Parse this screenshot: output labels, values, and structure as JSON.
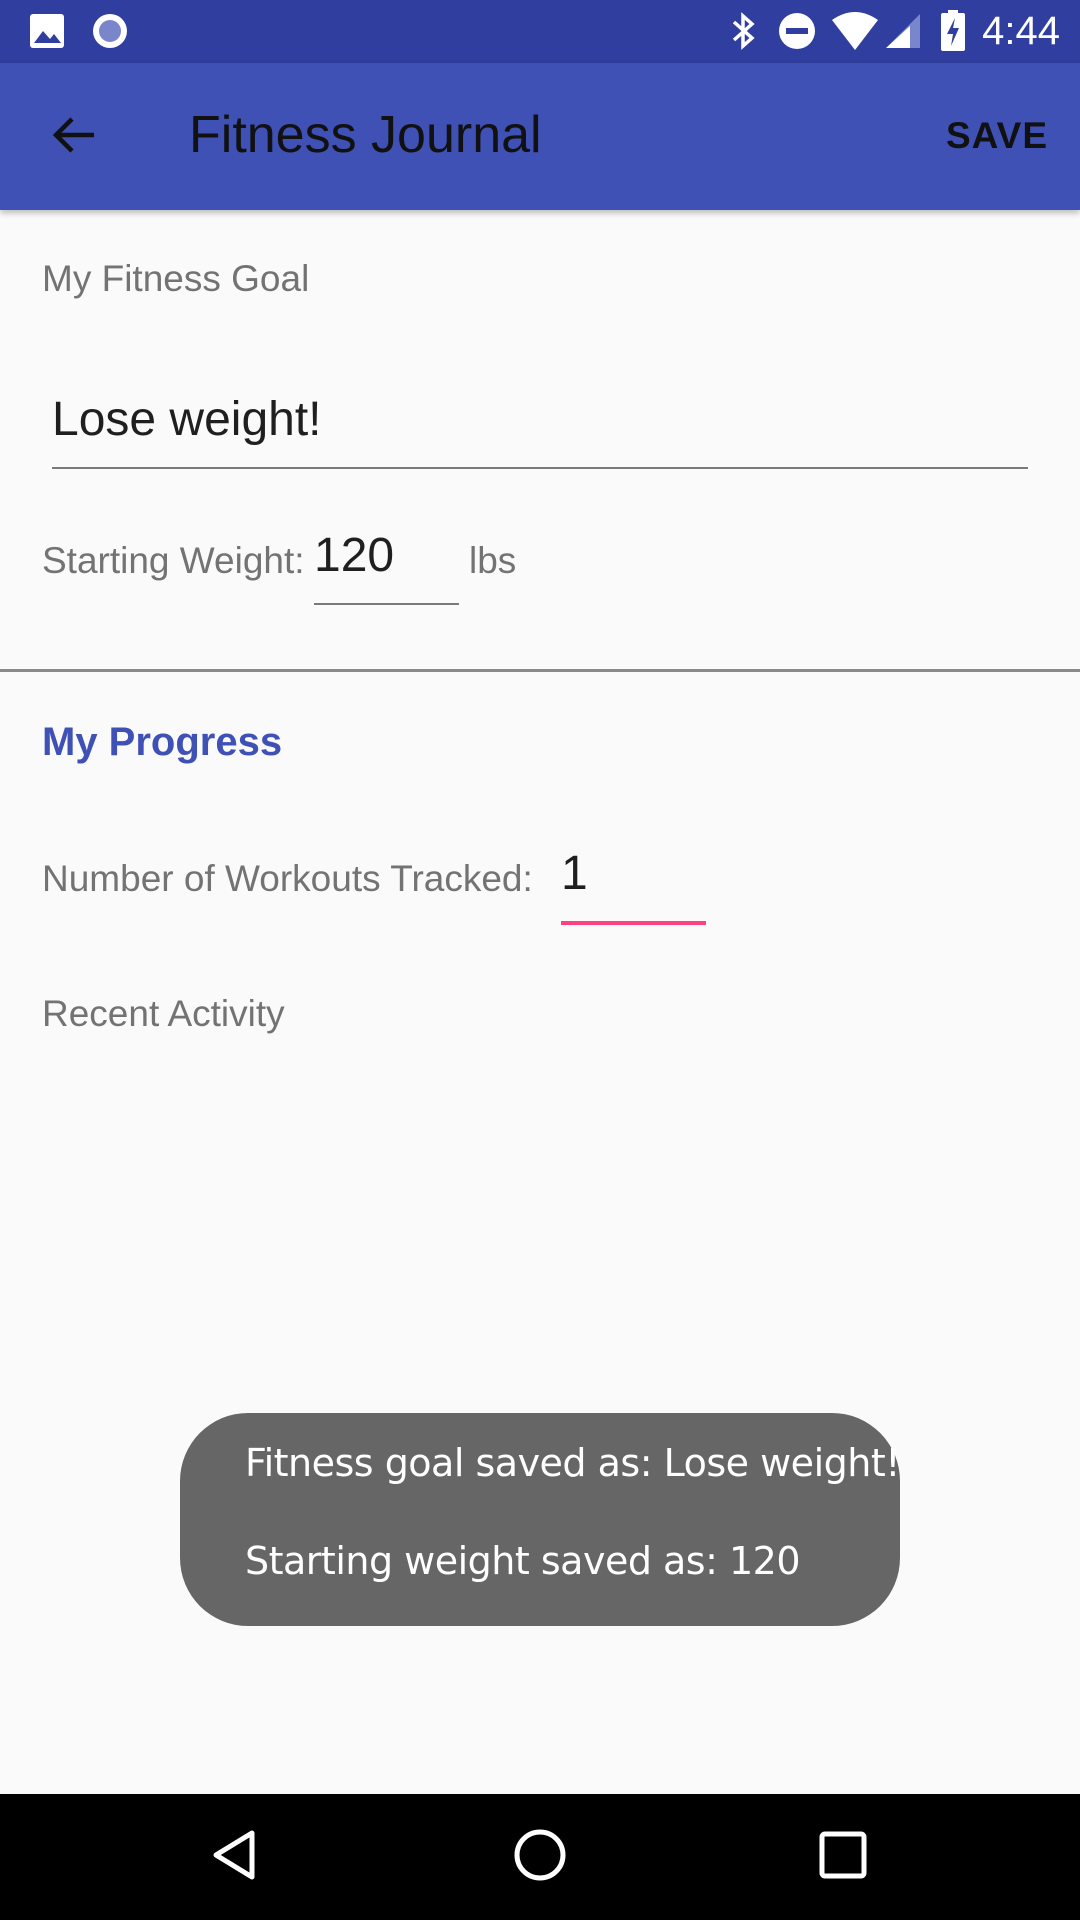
{
  "status_bar": {
    "time": "4:44",
    "icons": [
      "image-icon",
      "record-icon",
      "bluetooth-icon",
      "do-not-disturb-icon",
      "wifi-icon",
      "cell-signal-icon",
      "battery-charging-icon"
    ]
  },
  "app_bar": {
    "title": "Fitness Journal",
    "save_label": "SAVE",
    "back_icon": "back-arrow-icon"
  },
  "goal": {
    "label": "My Fitness Goal",
    "value": "Lose weight!"
  },
  "starting_weight": {
    "label": "Starting Weight:",
    "value": "120",
    "unit": "lbs"
  },
  "progress": {
    "title": "My Progress",
    "workouts_label": "Number of Workouts Tracked:",
    "workouts_value": "1",
    "recent_label": "Recent Activity"
  },
  "toast": {
    "line1": "Fitness goal saved as: Lose weight!",
    "line2": "Starting weight saved as: 120"
  },
  "nav_bar": {
    "icons": [
      "back-triangle-icon",
      "home-circle-icon",
      "recents-square-icon"
    ]
  },
  "colors": {
    "status_bar": "#303f9f",
    "app_bar": "#3f51b5",
    "accent": "#ff4081",
    "section_title": "#3f51b5",
    "toast": "#666666"
  }
}
